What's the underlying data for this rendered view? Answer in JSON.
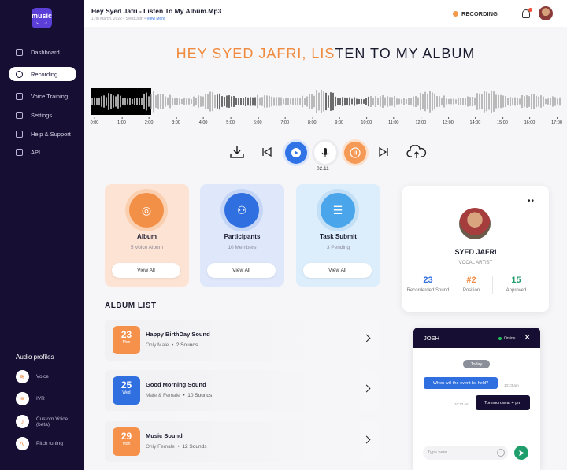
{
  "sidebar": {
    "logo_text": "music",
    "nav": [
      {
        "label": "Dashboard",
        "icon": "grid-icon"
      },
      {
        "label": "Recording",
        "icon": "record-icon",
        "active": true
      },
      {
        "label": "Voice Training",
        "icon": "wave-icon"
      },
      {
        "label": "Settings",
        "icon": "gear-icon"
      },
      {
        "label": "Help & Support",
        "icon": "help-icon"
      },
      {
        "label": "API",
        "icon": "api-icon"
      }
    ],
    "audio_profiles_title": "Audio profiles",
    "audio_profiles": [
      {
        "label": "Voice"
      },
      {
        "label": "IVR"
      },
      {
        "label": "Custom Voice (beta)"
      },
      {
        "label": "Pitch tuning"
      }
    ]
  },
  "header": {
    "title": "Hey Syed Jafri - Listen To My Album.Mp3",
    "date": "17th March, 2022",
    "author": "Syed Jafri",
    "view_more": "View More",
    "recording_label": "RECORDING"
  },
  "hero": {
    "part_orange": "HEY SYED JAFRI, LIS",
    "part_dark": "TEN TO MY ALBUM"
  },
  "timeline": [
    "0:00",
    "1:00",
    "2:00",
    "3:00",
    "4:00",
    "5:00",
    "6:00",
    "7:00",
    "8:00",
    "9:00",
    "10:00",
    "11:00",
    "12:00",
    "13:00",
    "14:00",
    "15:00",
    "16:00",
    "17:00"
  ],
  "player": {
    "current_time": "02.11"
  },
  "cards": [
    {
      "title": "Album",
      "subtitle": "5 Voice Album",
      "button": "View All"
    },
    {
      "title": "Participants",
      "subtitle": "10 Members",
      "button": "View All"
    },
    {
      "title": "Task Submit",
      "subtitle": "3 Pending",
      "button": "View All"
    }
  ],
  "album_list": {
    "title": "ALBUM LIST",
    "items": [
      {
        "day": "23",
        "weekday": "Mon",
        "name": "Happy BirthDay Sound",
        "gender": "Only Male",
        "sounds": "2 Sounds",
        "color": "#f5914b"
      },
      {
        "day": "25",
        "weekday": "Wed",
        "name": "Good Morning Sound",
        "gender": "Male & Female",
        "sounds": "10 Sounds",
        "color": "#2f6fe0"
      },
      {
        "day": "29",
        "weekday": "Mon",
        "name": "Music Sound",
        "gender": "Only Female",
        "sounds": "12 Sounds",
        "color": "#f5914b"
      }
    ]
  },
  "profile": {
    "name": "SYED JAFRI",
    "role": "VOCAL ARTIST",
    "stats": [
      {
        "value": "23",
        "label": "Recorderded Sound"
      },
      {
        "value": "#2",
        "label": "Position"
      },
      {
        "value": "15",
        "label": "Approved"
      }
    ]
  },
  "chat": {
    "name": "JOSH",
    "status": "Online",
    "today": "Today",
    "messages": [
      {
        "text": "When will the event be held?",
        "time": "10:23 am",
        "direction": "out"
      },
      {
        "text": "Tommorow at 4 pm",
        "time": "10:23 am",
        "direction": "in"
      }
    ],
    "input_placeholder": "Type here..."
  },
  "colors": {
    "accent_orange": "#f08a3e",
    "accent_blue": "#2f6fe0",
    "sidebar_bg": "#160f33"
  }
}
